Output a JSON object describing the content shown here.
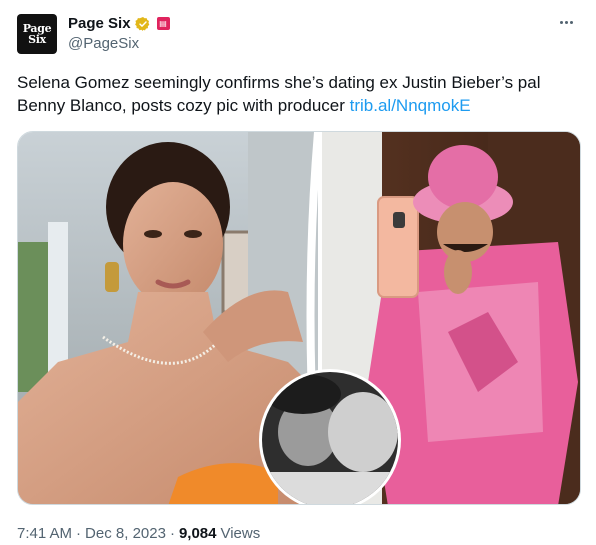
{
  "author": {
    "avatar_text_line1": "Page",
    "avatar_text_line2": "Six",
    "display_name": "Page Six",
    "handle": "@PageSix"
  },
  "tweet": {
    "text": "Selena Gomez seemingly confirms she’s dating ex Justin Bieber’s pal Benny Blanco, posts cozy pic with producer ",
    "link_text": "trib.al/NnqmokE"
  },
  "meta": {
    "time": "7:41 AM",
    "separator": "·",
    "date": "Dec 8, 2023",
    "views_count": "9,084",
    "views_label": "Views"
  },
  "icons": {
    "verified": "verified-badge-icon",
    "affiliate": "affiliate-badge-icon",
    "more": "more-options-icon"
  },
  "colors": {
    "link": "#1d9bf0",
    "verified_gold": "#e2b719",
    "affiliate_red": "#e0245e",
    "secondary_text": "#536471"
  }
}
